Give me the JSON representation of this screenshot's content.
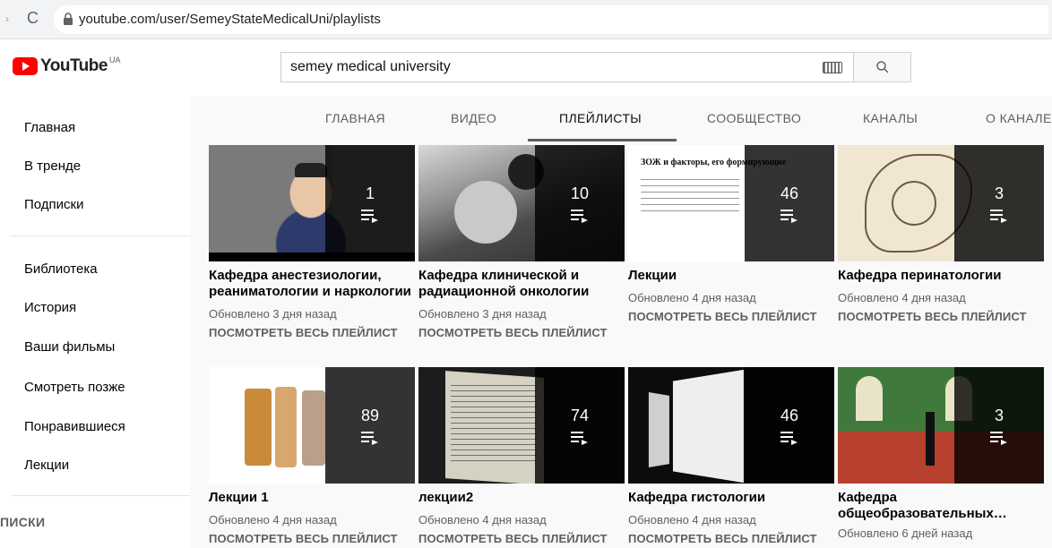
{
  "browser": {
    "url": "youtube.com/user/SemeyStateMedicalUni/playlists"
  },
  "masthead": {
    "logo_text": "YouTube",
    "region": "UA",
    "search_value": "semey medical university"
  },
  "sidebar": {
    "items": [
      {
        "label": "Главная"
      },
      {
        "label": "В тренде"
      },
      {
        "label": "Подписки"
      },
      {
        "label": "Библиотека"
      },
      {
        "label": "История"
      },
      {
        "label": "Ваши фильмы"
      },
      {
        "label": "Смотреть позже"
      },
      {
        "label": "Понравившиеся"
      },
      {
        "label": "Лекции"
      }
    ],
    "section_label": "ПИСКИ"
  },
  "tabs": [
    {
      "label": "ГЛАВНАЯ"
    },
    {
      "label": "ВИДЕО"
    },
    {
      "label": "ПЛЕЙЛИСТЫ",
      "active": true
    },
    {
      "label": "СООБЩЕСТВО"
    },
    {
      "label": "КАНАЛЫ"
    },
    {
      "label": "О КАНАЛЕ"
    }
  ],
  "view_all_label": "ПОСМОТРЕТЬ ВЕСЬ ПЛЕЙЛИСТ",
  "playlists": [
    {
      "title": "Кафедра анестезиологии, реаниматологии и наркологии",
      "count": "1",
      "updated": "Обновлено 3 дня назад"
    },
    {
      "title": "Кафедра клинической и радиационной онкологии",
      "count": "10",
      "updated": "Обновлено 3 дня назад"
    },
    {
      "title": "Лекции",
      "count": "46",
      "updated": "Обновлено 4 дня назад",
      "slide_title": "ЗОЖ и факторы, его формирующие"
    },
    {
      "title": "Кафедра перинатологии",
      "count": "3",
      "updated": "Обновлено 4 дня назад"
    },
    {
      "title": "Лекции 1",
      "count": "89",
      "updated": "Обновлено 4 дня назад"
    },
    {
      "title": "лекции2",
      "count": "74",
      "updated": "Обновлено 4 дня назад"
    },
    {
      "title": "Кафедра гистологии",
      "count": "46",
      "updated": "Обновлено 4 дня назад"
    },
    {
      "title": "Кафедра общеобразовательных…",
      "count": "3",
      "updated": "Обновлено 6 дней назад"
    }
  ]
}
